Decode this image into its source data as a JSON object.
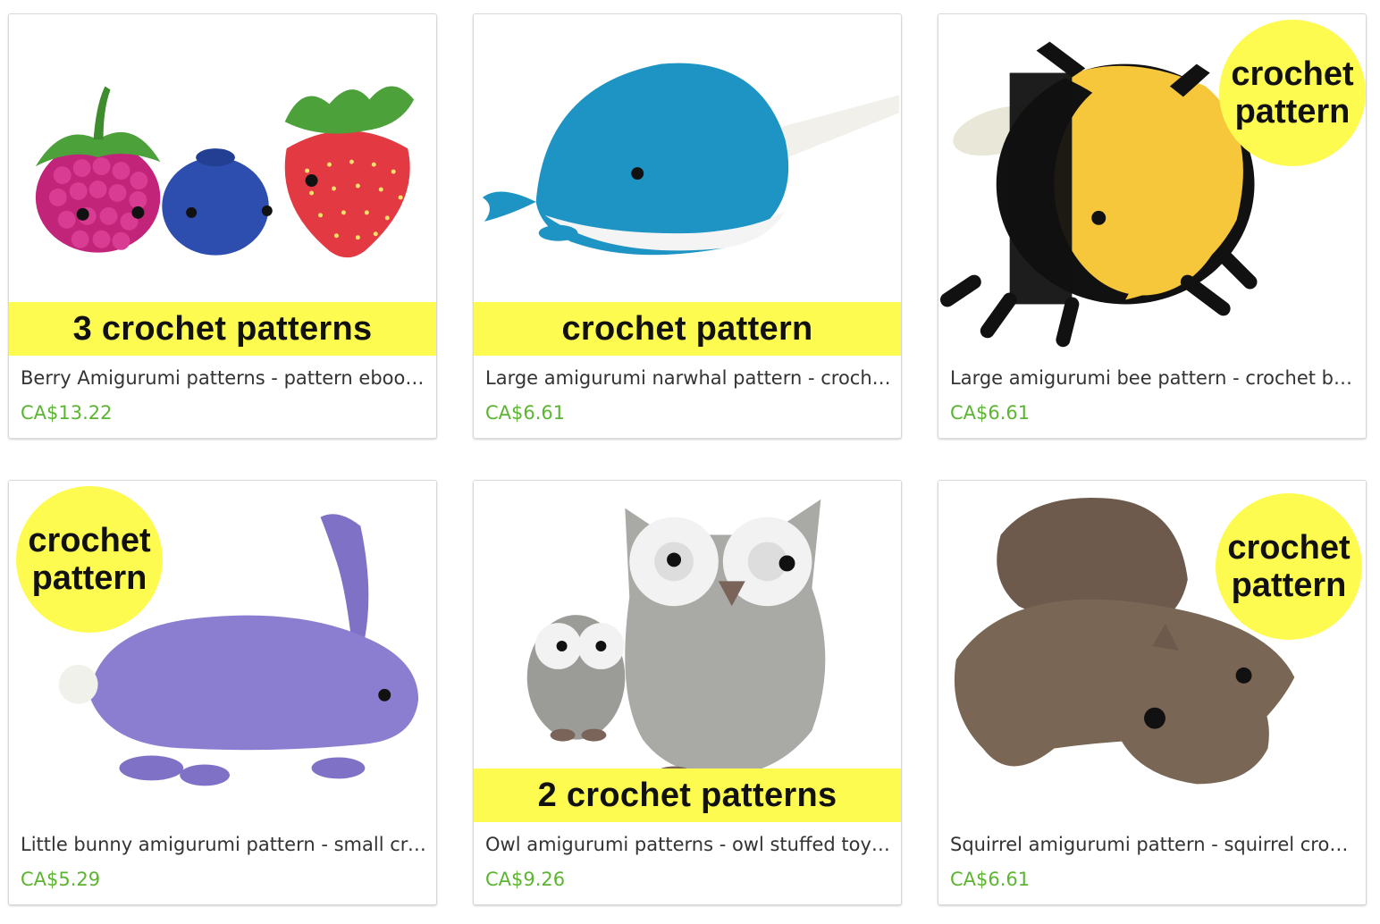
{
  "products": [
    {
      "title": "Berry Amigurumi patterns - pattern ebook - raspberry, blueberry and strawberry",
      "price": "CA$13.22",
      "label": "3 crochet patterns",
      "label_style": "banner"
    },
    {
      "title": "Large amigurumi narwhal pattern - crochet narwhal whale toy",
      "price": "CA$6.61",
      "label": "crochet pattern",
      "label_style": "banner"
    },
    {
      "title": "Large amigurumi bee pattern - crochet bumblebee toy",
      "price": "CA$6.61",
      "label_line1": "crochet",
      "label_line2": "pattern",
      "label_style": "badge"
    },
    {
      "title": "Little bunny amigurumi pattern - small crochet rabbit",
      "price": "CA$5.29",
      "label_line1": "crochet",
      "label_line2": "pattern",
      "label_style": "badge"
    },
    {
      "title": "Owl amigurumi patterns - owl stuffed toy crochet patterns",
      "price": "CA$9.26",
      "label": "2 crochet patterns",
      "label_style": "banner"
    },
    {
      "title": "Squirrel amigurumi pattern - squirrel crochet toy",
      "price": "CA$6.61",
      "label_line1": "crochet",
      "label_line2": "pattern",
      "label_style": "badge"
    }
  ],
  "colors": {
    "price": "#5cb531",
    "label_yellow": "#fdfb50"
  }
}
